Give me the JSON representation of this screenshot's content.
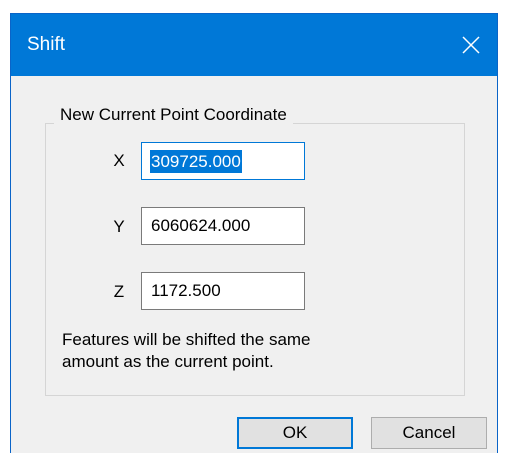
{
  "window": {
    "title": "Shift",
    "close_icon": "close-icon"
  },
  "group": {
    "legend": "New Current Point Coordinate"
  },
  "fields": {
    "x_label": "X",
    "x_value": "309725.000",
    "y_label": "Y",
    "y_value": "6060624.000",
    "z_label": "Z",
    "z_value": "1172.500"
  },
  "note": "Features will be shifted the same\namount as the current point.",
  "buttons": {
    "ok_label": "OK",
    "cancel_label": "Cancel"
  },
  "colors": {
    "titlebar": "#0078d7",
    "focus_border": "#0078d7",
    "selection": "#0078d7"
  }
}
